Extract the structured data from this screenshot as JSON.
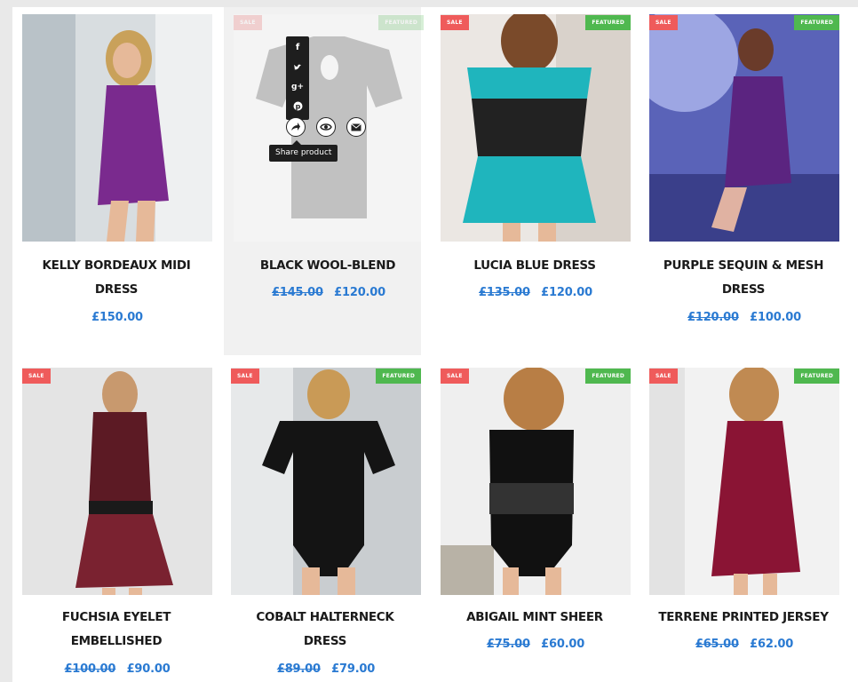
{
  "products": [
    {
      "title": "Kelly Bordeaux Midi Dress",
      "price": "£150.00",
      "old_price": "",
      "sale": false,
      "featured": false
    },
    {
      "title": "Black Wool-Blend",
      "price": "£120.00",
      "old_price": "£145.00",
      "sale": true,
      "featured": true
    },
    {
      "title": "Lucia Blue Dress",
      "price": "£120.00",
      "old_price": "£135.00",
      "sale": true,
      "featured": true
    },
    {
      "title": "Purple Sequin & Mesh Dress",
      "price": "£100.00",
      "old_price": "£120.00",
      "sale": true,
      "featured": true
    },
    {
      "title": "Fuchsia Eyelet Embellished",
      "price": "£90.00",
      "old_price": "£100.00",
      "sale": true,
      "featured": false
    },
    {
      "title": "Cobalt Halterneck Dress",
      "price": "£79.00",
      "old_price": "£89.00",
      "sale": true,
      "featured": true
    },
    {
      "title": "Abigail Mint Sheer",
      "price": "£60.00",
      "old_price": "£75.00",
      "sale": true,
      "featured": true
    },
    {
      "title": "Terrene Printed Jersey",
      "price": "£62.00",
      "old_price": "£65.00",
      "sale": true,
      "featured": true
    }
  ],
  "badges": {
    "sale": "SALE",
    "featured": "FEATURED"
  },
  "share": {
    "tooltip": "Share product",
    "networks": [
      "facebook-icon",
      "twitter-icon",
      "google-plus-icon",
      "pinterest-icon"
    ],
    "actions": [
      "share-icon",
      "quick-view-icon",
      "email-icon"
    ]
  },
  "colors": {
    "price": "#2a7ad2",
    "sale": "#ef5b5b",
    "featured": "#4fb84f"
  }
}
